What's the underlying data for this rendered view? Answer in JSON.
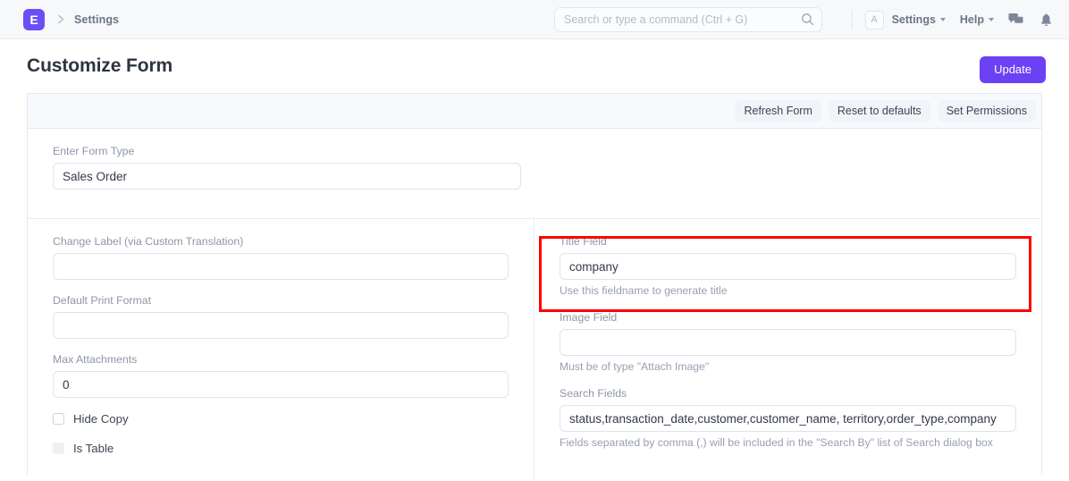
{
  "navbar": {
    "logo_letter": "E",
    "breadcrumb": "Settings",
    "search": {
      "placeholder": "Search or type a command (Ctrl + G)",
      "value": "",
      "icon": "search-icon"
    },
    "avatar_letter": "A",
    "menu_settings": "Settings",
    "menu_help": "Help",
    "icons": [
      "comment-icon",
      "bell-icon"
    ]
  },
  "page": {
    "title": "Customize Form",
    "update_button": "Update"
  },
  "toolbar": {
    "refresh_form": "Refresh Form",
    "reset_to_defaults": "Reset to defaults",
    "set_permissions": "Set Permissions"
  },
  "form": {
    "form_type": {
      "label": "Enter Form Type",
      "value": "Sales Order"
    },
    "left_column": [
      {
        "name": "change-label",
        "label": "Change Label (via Custom Translation)",
        "value": "",
        "help": ""
      },
      {
        "name": "default-print-format",
        "label": "Default Print Format",
        "value": "",
        "help": ""
      },
      {
        "name": "max-attachments",
        "label": "Max Attachments",
        "value": "0",
        "help": ""
      }
    ],
    "checkboxes": [
      {
        "name": "hide-copy",
        "label": "Hide Copy",
        "checked": false,
        "disabled": false
      },
      {
        "name": "is-table",
        "label": "Is Table",
        "checked": false,
        "disabled": true
      }
    ],
    "right_column": [
      {
        "name": "title-field",
        "label": "Title Field",
        "value": "company",
        "help": "Use this fieldname to generate title",
        "highlighted": true
      },
      {
        "name": "image-field",
        "label": "Image Field",
        "value": "",
        "help": "Must be of type \"Attach Image\"",
        "highlighted": false
      },
      {
        "name": "search-fields",
        "label": "Search Fields",
        "value": "status,transaction_date,customer,customer_name, territory,order_type,company",
        "help": "Fields separated by comma (,) will be included in the \"Search By\" list of Search dialog box",
        "highlighted": false
      }
    ]
  },
  "colors": {
    "brand": "#6c4ef6",
    "primary_button": "#6c41f4",
    "highlight": "#fe0000",
    "toolbar_bg": "#f7f9fc",
    "navbar_bg": "#f7f8fa"
  }
}
